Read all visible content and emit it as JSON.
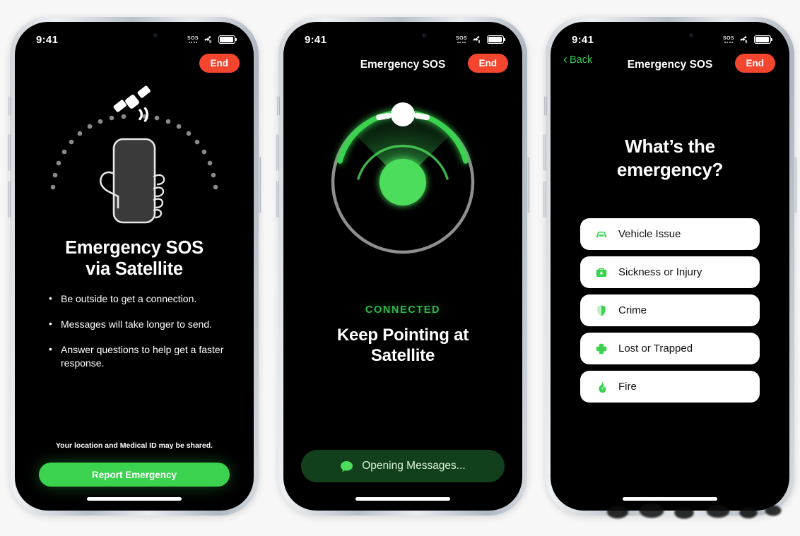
{
  "status_bar": {
    "time": "9:41",
    "sos_label": "SOS",
    "satellite_icon": "satellite-icon",
    "battery_icon": "battery-icon"
  },
  "phones": [
    {
      "name": "emergency-sos-intro",
      "nav": {
        "title": "",
        "end_label": "End",
        "back_label": ""
      },
      "illustration": "hand-holding-phone-with-satellite-arc",
      "heading_line1": "Emergency SOS",
      "heading_line2": "via Satellite",
      "bullets": [
        "Be outside to get a connection.",
        "Messages will take longer to send.",
        "Answer questions to help get a faster response."
      ],
      "note": "Your location and Medical ID may be shared.",
      "cta_label": "Report Emergency"
    },
    {
      "name": "pointing-at-satellite",
      "nav": {
        "title": "Emergency SOS",
        "end_label": "End",
        "back_label": ""
      },
      "status_text": "CONNECTED",
      "heading_line1": "Keep Pointing at",
      "heading_line2": "Satellite",
      "pill_label": "Opening Messages...",
      "pill_icon": "message-bubble-icon"
    },
    {
      "name": "emergency-questionnaire",
      "nav": {
        "title": "Emergency SOS",
        "end_label": "End",
        "back_label": "Back"
      },
      "heading_line1": "What’s the",
      "heading_line2": "emergency?",
      "options": [
        {
          "label": "Vehicle Issue",
          "icon": "car-icon"
        },
        {
          "label": "Sickness or Injury",
          "icon": "medical-kit-icon"
        },
        {
          "label": "Crime",
          "icon": "shield-icon"
        },
        {
          "label": "Lost or Trapped",
          "icon": "cross-icon"
        },
        {
          "label": "Fire",
          "icon": "flame-icon"
        }
      ]
    }
  ],
  "colors": {
    "accent_green": "#3ad24f",
    "bright_green": "#4ddd5c",
    "end_red": "#f4452f",
    "connected_green": "#33b74a",
    "pill_dark_green": "#12401c",
    "screen_black": "#000000",
    "page_background": "#f7f7f7"
  }
}
